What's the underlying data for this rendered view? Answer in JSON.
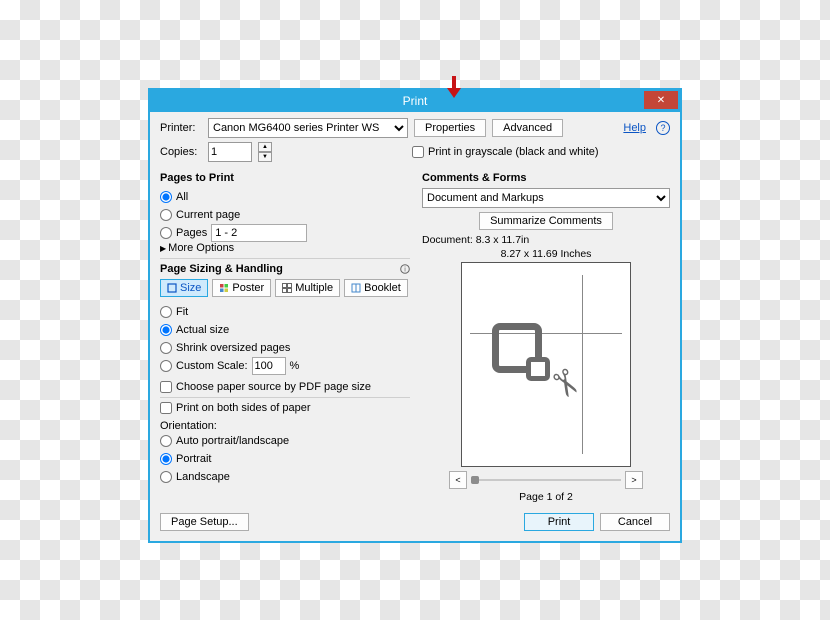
{
  "title": "Print",
  "printer": {
    "label": "Printer:",
    "selected": "Canon MG6400 series Printer WS",
    "properties_btn": "Properties",
    "advanced_btn": "Advanced"
  },
  "copies": {
    "label": "Copies:",
    "value": "1"
  },
  "grayscale_label": "Print in grayscale (black and white)",
  "help_label": "Help",
  "pages_to_print": {
    "title": "Pages to Print",
    "all": "All",
    "current": "Current page",
    "pages": "Pages",
    "pages_value": "1 - 2",
    "more": "More Options"
  },
  "sizing": {
    "title": "Page Sizing & Handling",
    "size": "Size",
    "poster": "Poster",
    "multiple": "Multiple",
    "booklet": "Booklet",
    "fit": "Fit",
    "actual": "Actual size",
    "shrink": "Shrink oversized pages",
    "custom": "Custom Scale:",
    "custom_value": "100",
    "percent": "%",
    "choose_source": "Choose paper source by PDF page size",
    "both_sides": "Print on both sides of paper"
  },
  "orientation": {
    "title": "Orientation:",
    "auto": "Auto portrait/landscape",
    "portrait": "Portrait",
    "landscape": "Landscape"
  },
  "comments": {
    "title": "Comments & Forms",
    "selected": "Document and Markups",
    "summarize": "Summarize Comments"
  },
  "preview": {
    "doc_size": "Document: 8.3 x 11.7in",
    "paper_size": "8.27 x 11.69 Inches",
    "page_of": "Page 1 of 2"
  },
  "footer": {
    "page_setup": "Page Setup...",
    "print": "Print",
    "cancel": "Cancel"
  }
}
